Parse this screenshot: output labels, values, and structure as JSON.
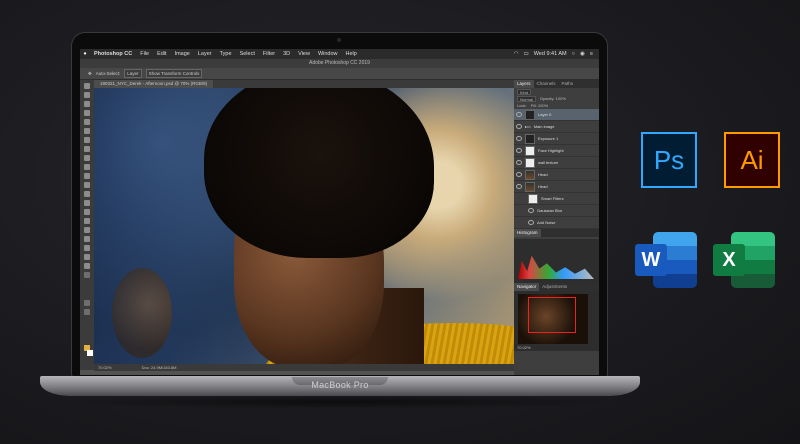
{
  "laptop": {
    "brand_label": "MacBook Pro"
  },
  "menubar": {
    "app_name": "Photoshop CC",
    "items": [
      "File",
      "Edit",
      "Image",
      "Layer",
      "Type",
      "Select",
      "Filter",
      "3D",
      "View",
      "Window",
      "Help"
    ],
    "clock": "Wed 9:41 AM"
  },
  "window": {
    "title": "Adobe Photoshop CC 2019",
    "document_tab": "190321_NYC_Derek - Afternoon.psd @ 70% (RGB/8)"
  },
  "options_bar": {
    "auto_select": "Auto-Select:",
    "auto_select_value": "Layer",
    "show_transform": "Show Transform Controls"
  },
  "status_bar": {
    "zoom": "70.02%",
    "doc_size": "Doc: 24.9M/183.8M"
  },
  "panels": {
    "tabs": [
      "Layers",
      "Channels",
      "Paths"
    ],
    "filter_kind": "Kind",
    "blend_mode": "Normal",
    "opacity_label": "Opacity: 100%",
    "lock_label": "Lock:",
    "fill_label": "Fill: 100%",
    "layers": [
      {
        "name": "Layer 0",
        "thumb": "dark"
      },
      {
        "name": "Main image",
        "thumb": "none"
      },
      {
        "name": "Exposure 1",
        "thumb": "dark"
      },
      {
        "name": "Face Highlight",
        "thumb": "white"
      },
      {
        "name": "wall texture",
        "thumb": "white"
      },
      {
        "name": "Head",
        "thumb": "photo"
      },
      {
        "name": "Head",
        "thumb": "photo"
      },
      {
        "name": "Smart Filters",
        "thumb": "white"
      },
      {
        "name": "Gaussian Blur",
        "thumb": "none"
      },
      {
        "name": "Add Noise",
        "thumb": "none"
      }
    ],
    "histogram_title": "Histogram",
    "navigator_tabs": [
      "Navigator",
      "Adjustments"
    ],
    "navigator_zoom": "70.02%"
  },
  "app_icons": {
    "photoshop": "Ps",
    "illustrator": "Ai",
    "word": "W",
    "excel": "X"
  },
  "colors": {
    "photoshop_accent": "#31a8ff",
    "illustrator_accent": "#ff9a00",
    "word_blue": "#185abd",
    "excel_green": "#107c41"
  }
}
